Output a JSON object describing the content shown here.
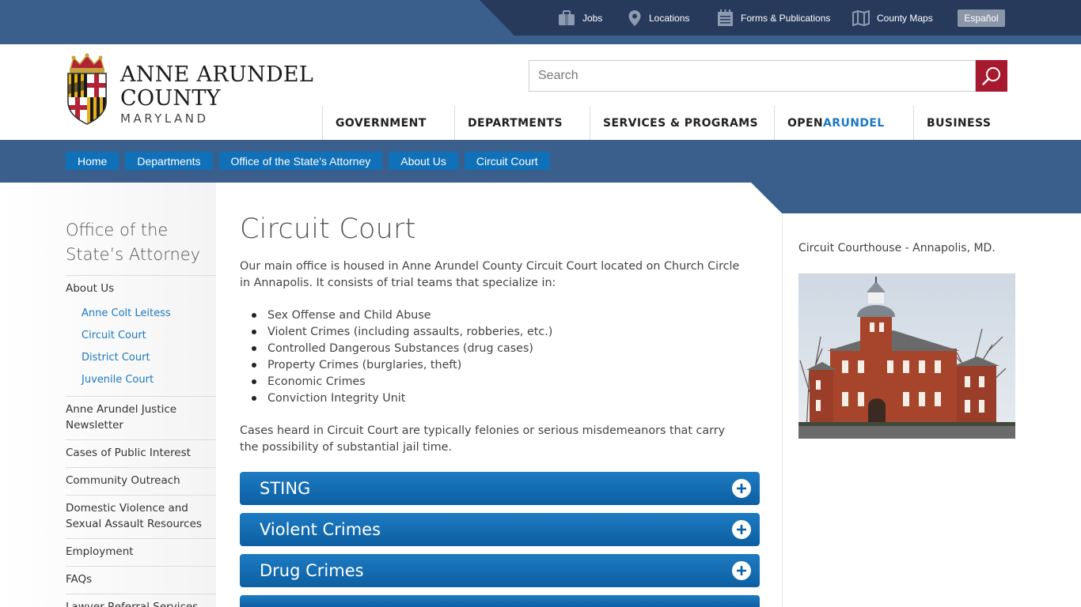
{
  "utility": {
    "items": [
      {
        "label": "Jobs",
        "icon": "briefcase-icon"
      },
      {
        "label": "Locations",
        "icon": "map-pin-icon"
      },
      {
        "label": "Forms & Publications",
        "icon": "forms-icon"
      },
      {
        "label": "County Maps",
        "icon": "map-icon"
      }
    ],
    "espanol": "Español"
  },
  "logo": {
    "line1": "ANNE ARUNDEL",
    "line2": "COUNTY",
    "line3": "MARYLAND"
  },
  "search": {
    "placeholder": "Search"
  },
  "nav": {
    "government": "GOVERNMENT",
    "departments": "DEPARTMENTS",
    "services": "SERVICES & PROGRAMS",
    "open_a": "OPEN",
    "open_b": "ARUNDEL",
    "business": "BUSINESS"
  },
  "breadcrumb": [
    "Home",
    "Departments",
    "Office of the State's Attorney",
    "About Us",
    "Circuit Court"
  ],
  "sidebar": {
    "title": "Office of the State’s Attorney",
    "about": "About Us",
    "sub": [
      "Anne Colt Leitess",
      "Circuit Court",
      "District Court",
      "Juvenile Court"
    ],
    "items": [
      "Anne Arundel Justice Newsletter",
      "Cases of Public Interest",
      "Community Outreach",
      "Domestic Violence and Sexual Assault Resources",
      "Employment",
      "FAQs",
      "Lawyer Referral Services"
    ]
  },
  "main": {
    "title": "Circuit Court",
    "intro": "Our main office is housed in Anne Arundel County Circuit Court located on Church Circle in Annapolis. It consists of trial teams that specialize in:",
    "bullets": [
      "Sex Offense and Child Abuse",
      "Violent Crimes (including assaults, robberies, etc.)",
      "Controlled Dangerous Substances (drug cases)",
      "Property Crimes (burglaries, theft)",
      "Economic Crimes",
      "Conviction Integrity Unit"
    ],
    "outro": "Cases heard in Circuit Court are typically felonies or serious misdemeanors that carry the possibility of substantial jail time.",
    "accordions": [
      "STING",
      "Violent Crimes",
      "Drug Crimes",
      ""
    ]
  },
  "aside": {
    "caption": "Circuit Courthouse - Annapolis, MD."
  },
  "colors": {
    "brand_blue": "#1070b8",
    "band_blue": "#3a5f8c",
    "dark_navy": "#273a5c",
    "search_red": "#a6192e"
  }
}
